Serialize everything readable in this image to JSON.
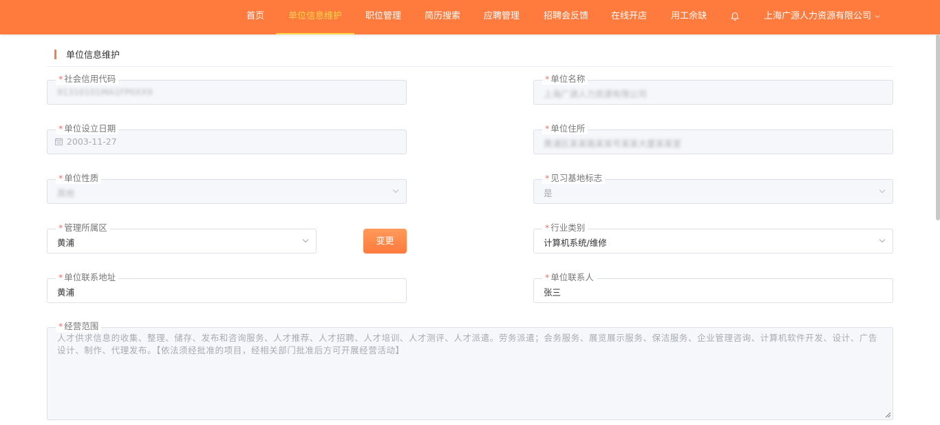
{
  "nav": {
    "items": [
      "首页",
      "单位信息维护",
      "职位管理",
      "简历搜索",
      "应聘管理",
      "招聘会反馈",
      "在线开店",
      "用工余缺"
    ],
    "active": "单位信息维护",
    "company": "上海广源人力资源有限公司"
  },
  "section": {
    "title": "单位信息维护"
  },
  "form": {
    "credit_code": {
      "label": "社会信用代码",
      "value": "91310101MA1FP0XX9"
    },
    "unit_name": {
      "label": "单位名称",
      "value": "上海广源人力资源有限公司"
    },
    "established_date": {
      "label": "单位设立日期",
      "value": "2003-11-27"
    },
    "unit_address": {
      "label": "单位住所",
      "value": "黄浦区某某路某某号某某大厦某某室"
    },
    "unit_nature": {
      "label": "单位性质",
      "value": "其他"
    },
    "internship_base": {
      "label": "见习基地标志",
      "value": "是"
    },
    "district": {
      "label": "管理所属区",
      "value": "黄浦"
    },
    "change_button": "变更",
    "industry": {
      "label": "行业类别",
      "value": "计算机系统/维修"
    },
    "contact_address": {
      "label": "单位联系地址",
      "value": "黄浦"
    },
    "contact_person": {
      "label": "单位联系人",
      "value": "张三"
    },
    "business_scope": {
      "label": "经营范围",
      "value": "人才供求信息的收集、整理、储存、发布和咨询服务、人才推荐、人才招聘、人才培训、人才测评、人才派遣。劳务派遣；会务服务、展览展示服务、保洁服务、企业管理咨询、计算机软件开发、设计、广告设计、制作、代理发布。【依法须经批准的项目，经相关部门批准后方可开展经营活动】"
    },
    "required_mark": "*"
  },
  "colors": {
    "primary": "#ff7a3d",
    "active_nav": "#ffd84a",
    "required": "#f56c6c"
  }
}
